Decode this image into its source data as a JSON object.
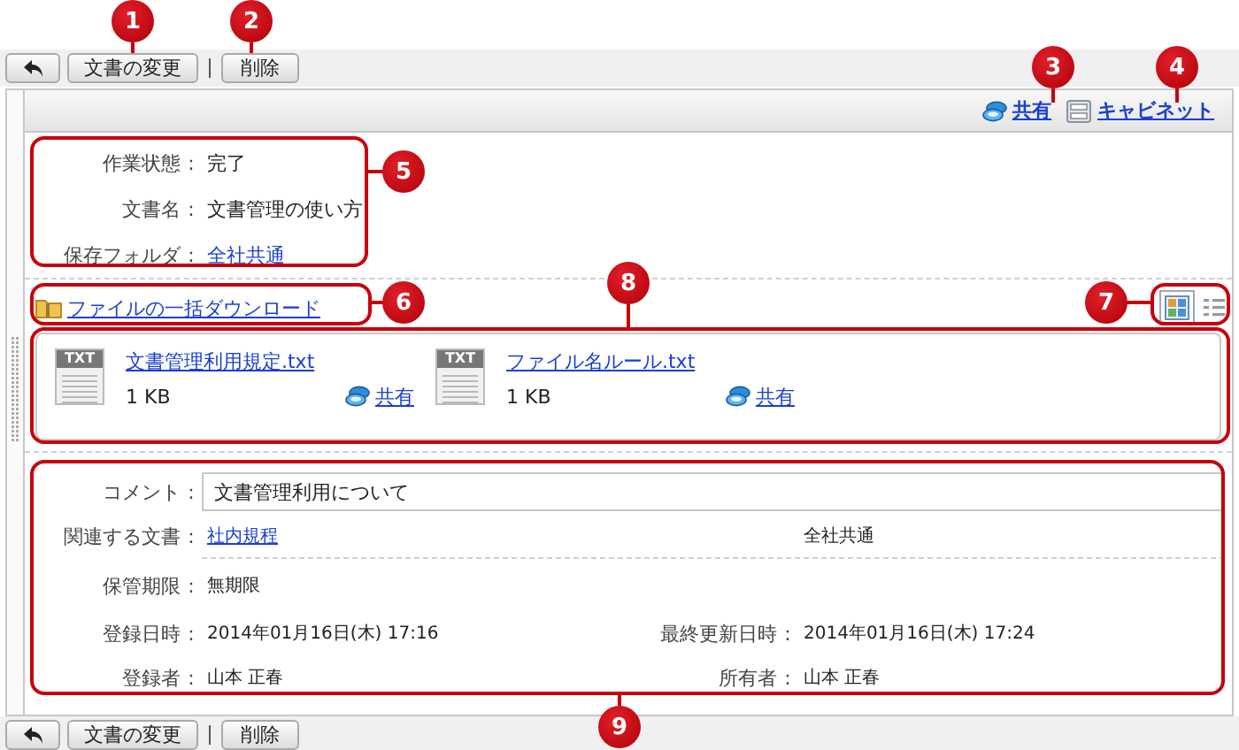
{
  "toolbar_top": {
    "buttons": [
      {
        "kind": "back"
      },
      {
        "kind": "edit",
        "label": "文書の変更"
      },
      {
        "kind": "delete",
        "label": "削除"
      }
    ]
  },
  "header_links": [
    {
      "kind": "share",
      "label": "共有"
    },
    {
      "kind": "cabinet",
      "label": "キャビネット"
    }
  ],
  "info": [
    {
      "label": "作業状態",
      "colon": ":",
      "value": "完了",
      "kind": "text"
    },
    {
      "label": "文書名",
      "colon": ":",
      "value": "文書管理の使い方",
      "kind": "text"
    },
    {
      "label": "保存フォルダ",
      "colon": ":",
      "value": "全社共通",
      "kind": "link"
    }
  ],
  "download_link": "ファイルの一括ダウンロード",
  "view_toggle": [
    {
      "kind": "thumbnail",
      "selected": true
    },
    {
      "kind": "list",
      "selected": false
    }
  ],
  "files": [
    {
      "badge": "TXT",
      "name": "文書管理利用規定.txt",
      "size": "1 KB",
      "share": "共有"
    },
    {
      "badge": "TXT",
      "name": "ファイル名ルール.txt",
      "size": "1 KB",
      "share": "共有"
    }
  ],
  "details": {
    "comment": {
      "label": "コメント",
      "colon": ":",
      "value": "文書管理利用について"
    },
    "related": {
      "label": "関連する文書",
      "colon": ":",
      "link": "社内規程",
      "folder": "全社共通"
    },
    "retention": {
      "label": "保管期限",
      "colon": ":",
      "value": "無期限"
    },
    "registered": {
      "label": "登録日時",
      "colon": ":",
      "value": "2014年01月16日(木) 17:16"
    },
    "updated": {
      "label": "最終更新日時",
      "colon": ":",
      "value": "2014年01月16日(木) 17:24"
    },
    "registrant": {
      "label": "登録者",
      "colon": ":",
      "value": "山本 正春"
    },
    "owner": {
      "label": "所有者",
      "colon": ":",
      "value": "山本 正春"
    }
  },
  "toolbar_bottom": {
    "buttons": [
      {
        "kind": "back"
      },
      {
        "kind": "edit",
        "label": "文書の変更"
      },
      {
        "kind": "delete",
        "label": "削除"
      }
    ]
  },
  "callouts": [
    "1",
    "2",
    "3",
    "4",
    "5",
    "6",
    "7",
    "8",
    "9"
  ]
}
